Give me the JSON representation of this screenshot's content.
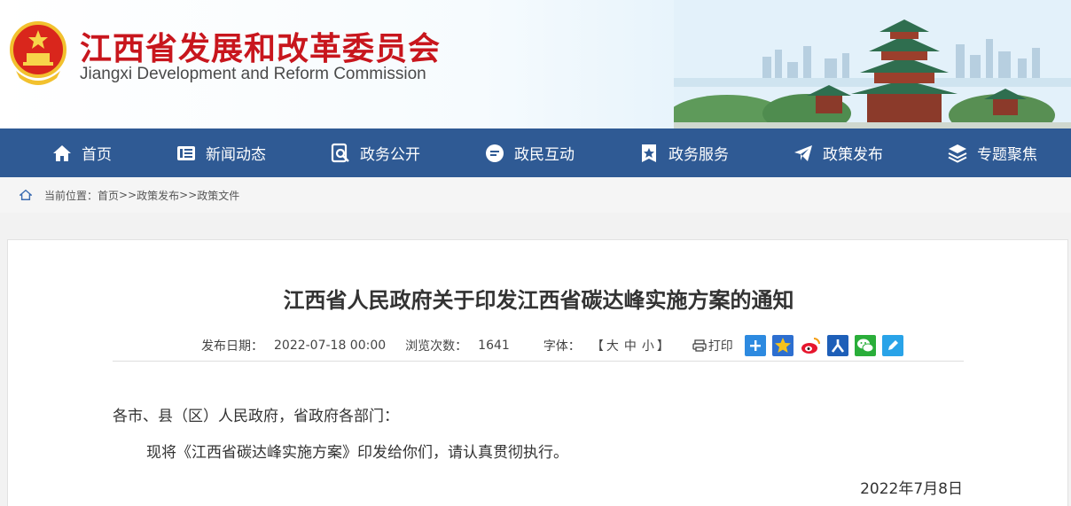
{
  "header": {
    "title_cn": "江西省发展和改革委员会",
    "title_en": "Jiangxi Development and Reform Commission"
  },
  "nav": {
    "items": [
      {
        "label": "首页",
        "icon": "home-icon"
      },
      {
        "label": "新闻动态",
        "icon": "news-icon"
      },
      {
        "label": "政务公开",
        "icon": "search-doc-icon"
      },
      {
        "label": "政民互动",
        "icon": "chat-icon"
      },
      {
        "label": "政务服务",
        "icon": "star-badge-icon"
      },
      {
        "label": "政策发布",
        "icon": "paper-plane-icon"
      },
      {
        "label": "专题聚焦",
        "icon": "layers-icon"
      }
    ]
  },
  "breadcrumb": {
    "prefix": "当前位置：",
    "items": [
      "首页",
      "政策发布",
      "政策文件"
    ],
    "separator": ">>"
  },
  "article": {
    "title": "江西省人民政府关于印发江西省碳达峰实施方案的通知",
    "publish_label": "发布日期：",
    "publish_date": "2022-07-18 00:00",
    "views_label": "浏览次数：",
    "views": "1641",
    "font_label": "字体：",
    "font_open": "【",
    "font_sizes": [
      "大",
      "中",
      "小"
    ],
    "font_close": "】",
    "print_label": "打印",
    "share_icons": [
      "add-icon",
      "favorite-star-icon",
      "weibo-icon",
      "people-icon",
      "wechat-icon",
      "edit-icon"
    ],
    "salutation": "各市、县（区）人民政府，省政府各部门：",
    "body": "现将《江西省碳达峰实施方案》印发给你们，请认真贯彻执行。",
    "date": "2022年7月8日"
  },
  "colors": {
    "brand_red": "#c8161d",
    "nav_blue": "#2f5a94"
  }
}
